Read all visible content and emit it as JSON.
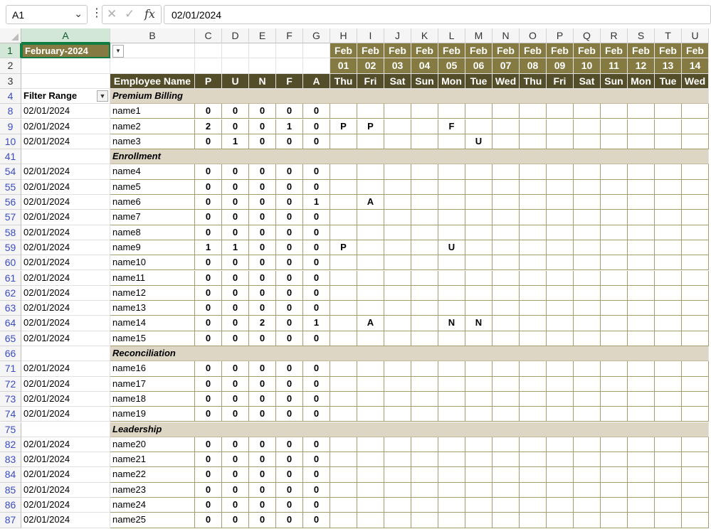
{
  "formula_bar": {
    "name_box": "A1",
    "formula": "02/01/2024"
  },
  "columns": [
    {
      "letter": "A",
      "w": 125
    },
    {
      "letter": "B",
      "w": 119
    },
    {
      "letter": "C",
      "w": 38
    },
    {
      "letter": "D",
      "w": 38
    },
    {
      "letter": "E",
      "w": 38
    },
    {
      "letter": "F",
      "w": 38
    },
    {
      "letter": "G",
      "w": 38
    },
    {
      "letter": "H",
      "w": 38
    },
    {
      "letter": "I",
      "w": 38
    },
    {
      "letter": "J",
      "w": 38
    },
    {
      "letter": "K",
      "w": 38
    },
    {
      "letter": "L",
      "w": 38
    },
    {
      "letter": "M",
      "w": 38
    },
    {
      "letter": "N",
      "w": 38
    },
    {
      "letter": "O",
      "w": 38
    },
    {
      "letter": "P",
      "w": 38
    },
    {
      "letter": "Q",
      "w": 38
    },
    {
      "letter": "R",
      "w": 38
    },
    {
      "letter": "S",
      "w": 38
    },
    {
      "letter": "T",
      "w": 38
    },
    {
      "letter": "U",
      "w": 38
    }
  ],
  "header": {
    "month": "February-2024",
    "employee_col": "Employee Name",
    "filter_label": "Filter Range",
    "code_headers": [
      "P",
      "U",
      "N",
      "F",
      "A"
    ],
    "dates": [
      {
        "month": "Feb",
        "day": "01",
        "dow": "Thu"
      },
      {
        "month": "Feb",
        "day": "02",
        "dow": "Fri"
      },
      {
        "month": "Feb",
        "day": "03",
        "dow": "Sat"
      },
      {
        "month": "Feb",
        "day": "04",
        "dow": "Sun"
      },
      {
        "month": "Feb",
        "day": "05",
        "dow": "Mon"
      },
      {
        "month": "Feb",
        "day": "06",
        "dow": "Tue"
      },
      {
        "month": "Feb",
        "day": "07",
        "dow": "Wed"
      },
      {
        "month": "Feb",
        "day": "08",
        "dow": "Thu"
      },
      {
        "month": "Feb",
        "day": "09",
        "dow": "Fri"
      },
      {
        "month": "Feb",
        "day": "10",
        "dow": "Sat"
      },
      {
        "month": "Feb",
        "day": "11",
        "dow": "Sun"
      },
      {
        "month": "Feb",
        "day": "12",
        "dow": "Mon"
      },
      {
        "month": "Feb",
        "day": "13",
        "dow": "Tue"
      },
      {
        "month": "Feb",
        "day": "14",
        "dow": "Wed"
      }
    ]
  },
  "rows": [
    {
      "r": "8",
      "type": "data",
      "date": "02/01/2024",
      "name": "name1",
      "counts": [
        "0",
        "0",
        "0",
        "0",
        "0"
      ],
      "marks": {}
    },
    {
      "r": "9",
      "type": "data",
      "date": "02/01/2024",
      "name": "name2",
      "counts": [
        "2",
        "0",
        "0",
        "1",
        "0"
      ],
      "marks": {
        "0": "P",
        "1": "P",
        "4": "F"
      }
    },
    {
      "r": "10",
      "type": "data",
      "date": "02/01/2024",
      "name": "name3",
      "counts": [
        "0",
        "1",
        "0",
        "0",
        "0"
      ],
      "marks": {
        "5": "U"
      }
    },
    {
      "r": "41",
      "type": "section",
      "label": "Enrollment"
    },
    {
      "r": "54",
      "type": "data",
      "date": "02/01/2024",
      "name": "name4",
      "counts": [
        "0",
        "0",
        "0",
        "0",
        "0"
      ],
      "marks": {}
    },
    {
      "r": "55",
      "type": "data",
      "date": "02/01/2024",
      "name": "name5",
      "counts": [
        "0",
        "0",
        "0",
        "0",
        "0"
      ],
      "marks": {}
    },
    {
      "r": "56",
      "type": "data",
      "date": "02/01/2024",
      "name": "name6",
      "counts": [
        "0",
        "0",
        "0",
        "0",
        "1"
      ],
      "marks": {
        "1": "A"
      }
    },
    {
      "r": "57",
      "type": "data",
      "date": "02/01/2024",
      "name": "name7",
      "counts": [
        "0",
        "0",
        "0",
        "0",
        "0"
      ],
      "marks": {}
    },
    {
      "r": "58",
      "type": "data",
      "date": "02/01/2024",
      "name": "name8",
      "counts": [
        "0",
        "0",
        "0",
        "0",
        "0"
      ],
      "marks": {}
    },
    {
      "r": "59",
      "type": "data",
      "date": "02/01/2024",
      "name": "name9",
      "counts": [
        "1",
        "1",
        "0",
        "0",
        "0"
      ],
      "marks": {
        "0": "P",
        "4": "U"
      }
    },
    {
      "r": "60",
      "type": "data",
      "date": "02/01/2024",
      "name": "name10",
      "counts": [
        "0",
        "0",
        "0",
        "0",
        "0"
      ],
      "marks": {}
    },
    {
      "r": "61",
      "type": "data",
      "date": "02/01/2024",
      "name": "name11",
      "counts": [
        "0",
        "0",
        "0",
        "0",
        "0"
      ],
      "marks": {}
    },
    {
      "r": "62",
      "type": "data",
      "date": "02/01/2024",
      "name": "name12",
      "counts": [
        "0",
        "0",
        "0",
        "0",
        "0"
      ],
      "marks": {}
    },
    {
      "r": "63",
      "type": "data",
      "date": "02/01/2024",
      "name": "name13",
      "counts": [
        "0",
        "0",
        "0",
        "0",
        "0"
      ],
      "marks": {}
    },
    {
      "r": "64",
      "type": "data",
      "date": "02/01/2024",
      "name": "name14",
      "counts": [
        "0",
        "0",
        "2",
        "0",
        "1"
      ],
      "marks": {
        "1": "A",
        "4": "N",
        "5": "N"
      }
    },
    {
      "r": "65",
      "type": "data",
      "date": "02/01/2024",
      "name": "name15",
      "counts": [
        "0",
        "0",
        "0",
        "0",
        "0"
      ],
      "marks": {}
    },
    {
      "r": "66",
      "type": "section",
      "label": "Reconciliation"
    },
    {
      "r": "71",
      "type": "data",
      "date": "02/01/2024",
      "name": "name16",
      "counts": [
        "0",
        "0",
        "0",
        "0",
        "0"
      ],
      "marks": {}
    },
    {
      "r": "72",
      "type": "data",
      "date": "02/01/2024",
      "name": "name17",
      "counts": [
        "0",
        "0",
        "0",
        "0",
        "0"
      ],
      "marks": {}
    },
    {
      "r": "73",
      "type": "data",
      "date": "02/01/2024",
      "name": "name18",
      "counts": [
        "0",
        "0",
        "0",
        "0",
        "0"
      ],
      "marks": {}
    },
    {
      "r": "74",
      "type": "data",
      "date": "02/01/2024",
      "name": "name19",
      "counts": [
        "0",
        "0",
        "0",
        "0",
        "0"
      ],
      "marks": {}
    },
    {
      "r": "75",
      "type": "section",
      "label": "Leadership"
    },
    {
      "r": "82",
      "type": "data",
      "date": "02/01/2024",
      "name": "name20",
      "counts": [
        "0",
        "0",
        "0",
        "0",
        "0"
      ],
      "marks": {}
    },
    {
      "r": "83",
      "type": "data",
      "date": "02/01/2024",
      "name": "name21",
      "counts": [
        "0",
        "0",
        "0",
        "0",
        "0"
      ],
      "marks": {}
    },
    {
      "r": "84",
      "type": "data",
      "date": "02/01/2024",
      "name": "name22",
      "counts": [
        "0",
        "0",
        "0",
        "0",
        "0"
      ],
      "marks": {}
    },
    {
      "r": "85",
      "type": "data",
      "date": "02/01/2024",
      "name": "name23",
      "counts": [
        "0",
        "0",
        "0",
        "0",
        "0"
      ],
      "marks": {}
    },
    {
      "r": "86",
      "type": "data",
      "date": "02/01/2024",
      "name": "name24",
      "counts": [
        "0",
        "0",
        "0",
        "0",
        "0"
      ],
      "marks": {}
    },
    {
      "r": "87",
      "type": "data",
      "date": "02/01/2024",
      "name": "name25",
      "counts": [
        "0",
        "0",
        "0",
        "0",
        "0"
      ],
      "marks": {}
    }
  ],
  "first_section": {
    "r": "4",
    "label": "Premium Billing"
  },
  "header_rows": [
    "1",
    "2",
    "3"
  ]
}
